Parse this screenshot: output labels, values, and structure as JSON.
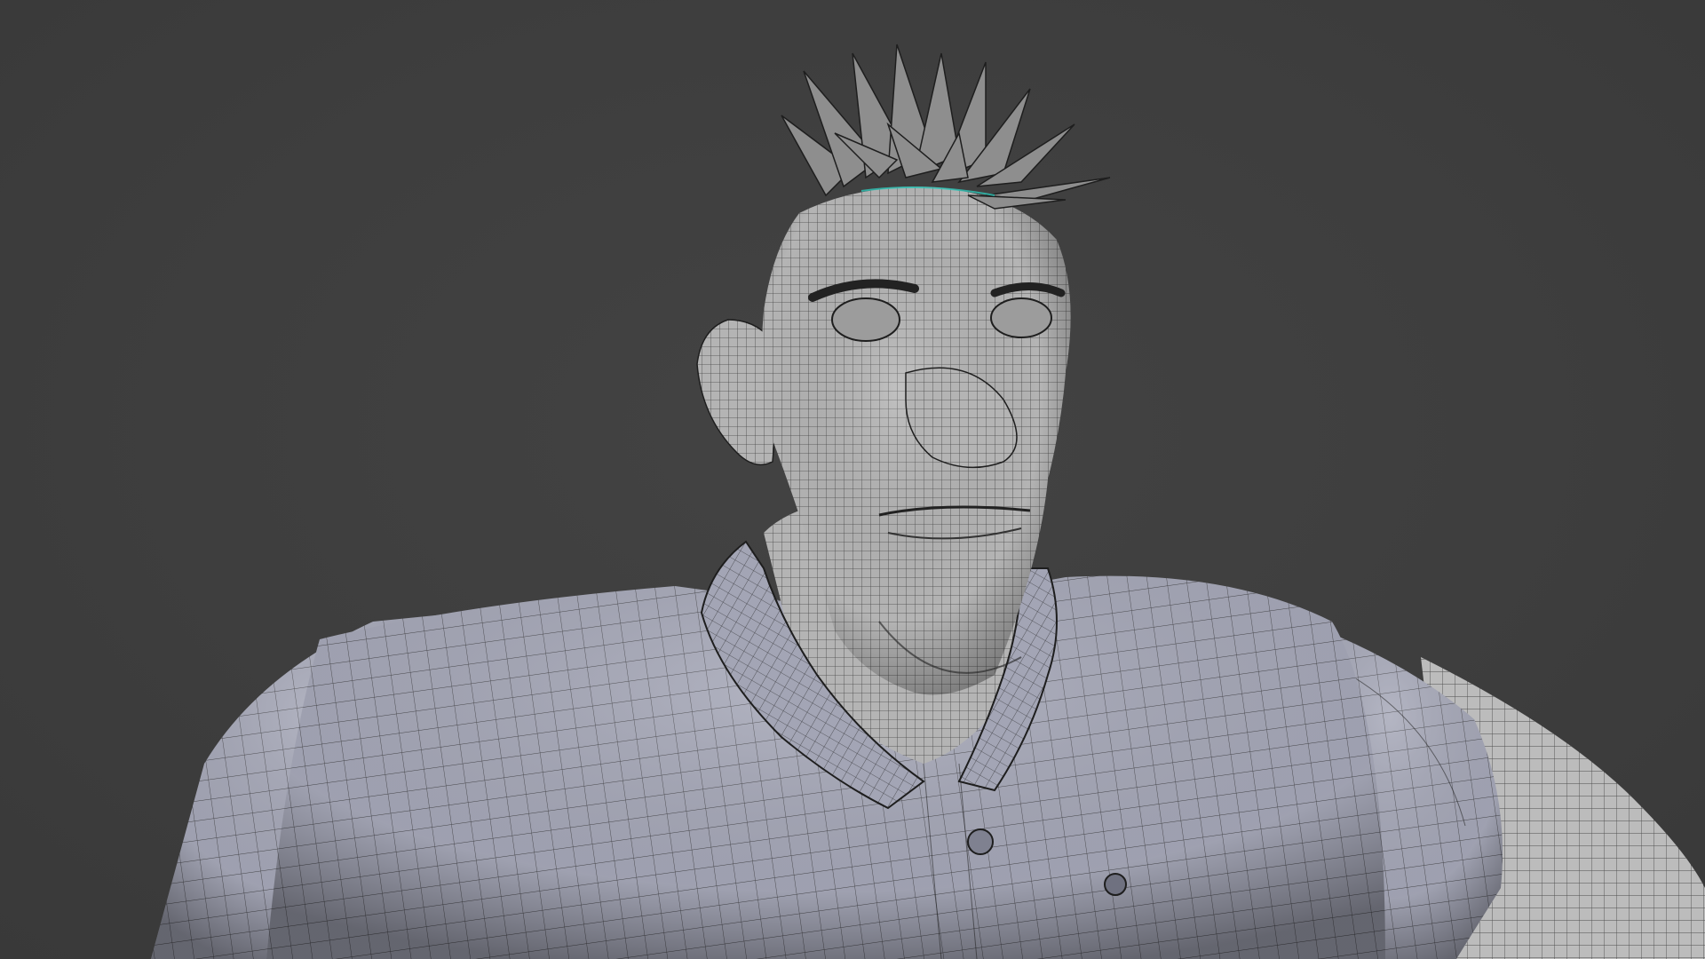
{
  "viewport": {
    "background_color": "#3d3d3d",
    "mesh_skin_color": "#b9b9b9",
    "mesh_shirt_color": "#a6a8b8",
    "wire_color": "#1e1e1e",
    "selection_accent_color": "#2ec4b6"
  },
  "object": {
    "description_icon": "character-mesh-icon"
  }
}
